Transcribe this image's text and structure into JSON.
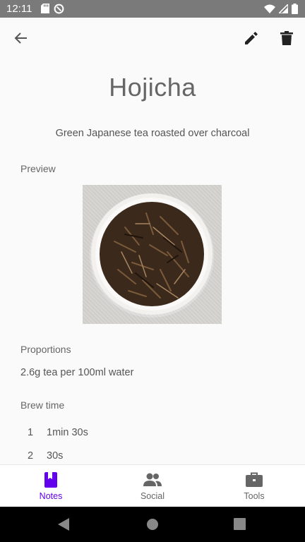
{
  "status_bar": {
    "time": "12:11"
  },
  "app_bar": {
    "back_icon": "arrow-back-icon",
    "edit_icon": "pencil-icon",
    "delete_icon": "trash-icon"
  },
  "note": {
    "title": "Hojicha",
    "subtitle": "Green Japanese tea roasted over charcoal",
    "preview_label": "Preview",
    "proportions_label": "Proportions",
    "proportions_value": "2.6g tea per 100ml water",
    "brew_time_label": "Brew time",
    "brew_steps": [
      {
        "index": "1",
        "time": "1min 30s"
      },
      {
        "index": "2",
        "time": "30s"
      }
    ]
  },
  "bottom_nav": {
    "items": [
      {
        "label": "Notes",
        "icon": "bookmark-book-icon",
        "active": true
      },
      {
        "label": "Social",
        "icon": "people-icon",
        "active": false
      },
      {
        "label": "Tools",
        "icon": "briefcase-icon",
        "active": false
      }
    ],
    "active_color": "#6200ee",
    "inactive_color": "#666666"
  }
}
